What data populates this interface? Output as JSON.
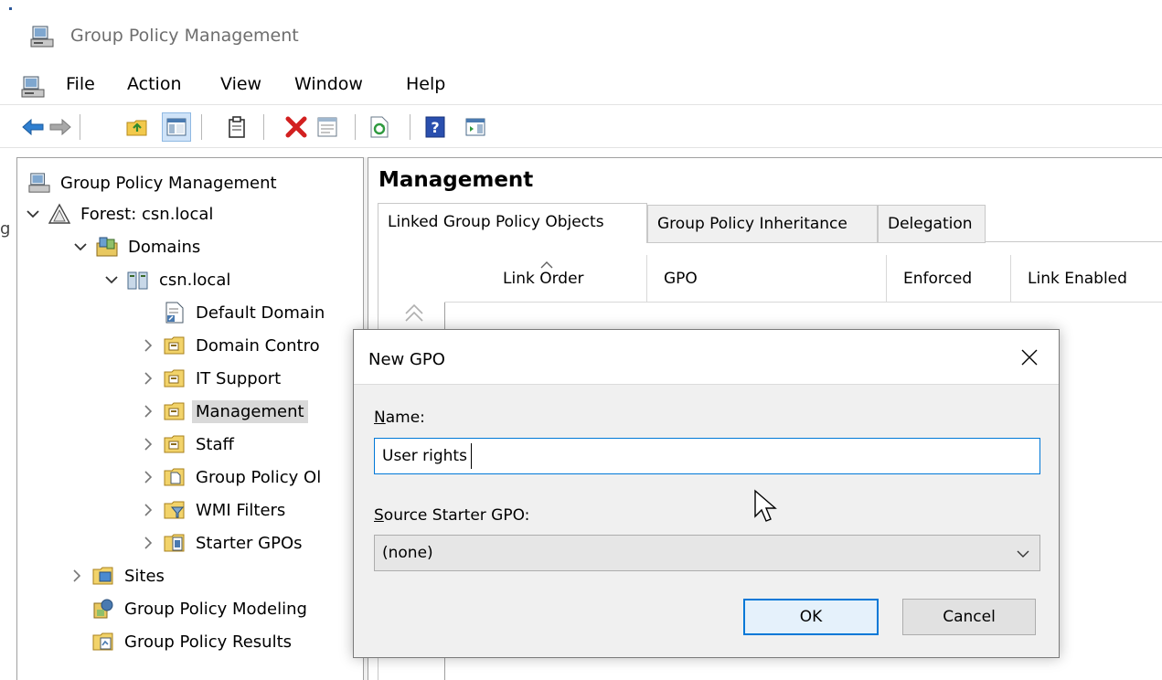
{
  "window": {
    "title": "Group Policy Management"
  },
  "left_edge_char": "g",
  "menu": {
    "items": [
      "File",
      "Action",
      "View",
      "Window",
      "Help"
    ]
  },
  "toolbar": {
    "buttons": [
      "back-arrow-icon",
      "forward-arrow-icon",
      "up-folder-icon",
      "show-hide-tree-icon",
      "clipboard-icon",
      "delete-icon",
      "properties-icon",
      "refresh-icon",
      "help-icon",
      "action-pane-icon"
    ]
  },
  "tree": {
    "root": "Group Policy Management",
    "forest": "Forest: csn.local",
    "domains": "Domains",
    "domain": "csn.local",
    "default_domain": "Default Domain",
    "domain_controllers": "Domain Contro",
    "it_support": "IT Support",
    "management": "Management",
    "staff": "Staff",
    "group_policy_objects": "Group Policy Ol",
    "wmi_filters": "WMI Filters",
    "starter_gpos": "Starter GPOs",
    "sites": "Sites",
    "modeling": "Group Policy Modeling",
    "results": "Group Policy Results"
  },
  "main": {
    "title": "Management",
    "tabs": [
      {
        "label": "Linked Group Policy Objects",
        "active": true
      },
      {
        "label": "Group Policy Inheritance",
        "active": false
      },
      {
        "label": "Delegation",
        "active": false
      }
    ],
    "columns": [
      "Link Order",
      "GPO",
      "Enforced",
      "Link Enabled"
    ]
  },
  "dialog": {
    "title": "New GPO",
    "name_label_accel": "N",
    "name_label_rest": "ame:",
    "name_value": "User rights",
    "source_label_accel": "S",
    "source_label_rest": "ource Starter GPO:",
    "source_value": "(none)",
    "ok_label": "OK",
    "cancel_label": "Cancel"
  },
  "colors": {
    "accent": "#0078d7",
    "selection": "#d9d9d9",
    "dialog_body": "#f0f0f0"
  }
}
